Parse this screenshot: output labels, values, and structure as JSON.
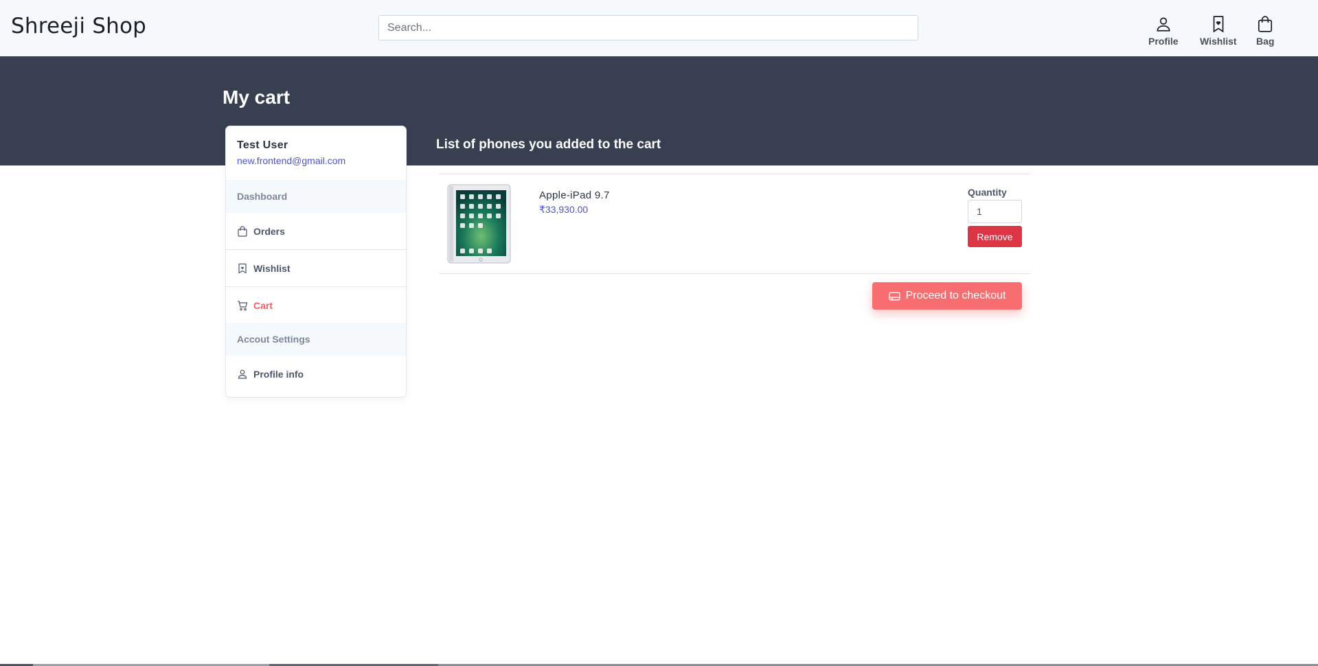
{
  "header": {
    "brand": "Shreeji Shop",
    "search_placeholder": "Search...",
    "nav": {
      "profile": "Profile",
      "wishlist": "Wishlist",
      "bag": "Bag"
    }
  },
  "banner": {
    "title": "My cart",
    "subtitle": "List of phones you added to the cart"
  },
  "sidebar": {
    "user_name": "Test User",
    "user_email": "new.frontend@gmail.com",
    "dashboard_heading": "Dashboard",
    "orders": "Orders",
    "wishlist": "Wishlist",
    "cart": "Cart",
    "account_heading": "Accout Settings",
    "profile_info": "Profile info"
  },
  "cart": {
    "items": [
      {
        "name": "Apple-iPad 9.7",
        "price": "₹33,930.00",
        "quantity_label": "Quantity",
        "quantity": "1",
        "remove_label": "Remove"
      }
    ],
    "checkout_label": "Proceed to checkout"
  },
  "colors": {
    "banner": "#373f50",
    "accent": "#f25b5e",
    "checkout": "#f86d70",
    "remove": "#dc3545",
    "link": "#4e54c8"
  },
  "icons": {
    "profile": "person-icon",
    "wishlist": "bookmark-heart-icon",
    "bag": "bag-icon",
    "orders": "bag-icon",
    "cart": "cart-icon",
    "checkout": "credit-card-icon"
  }
}
